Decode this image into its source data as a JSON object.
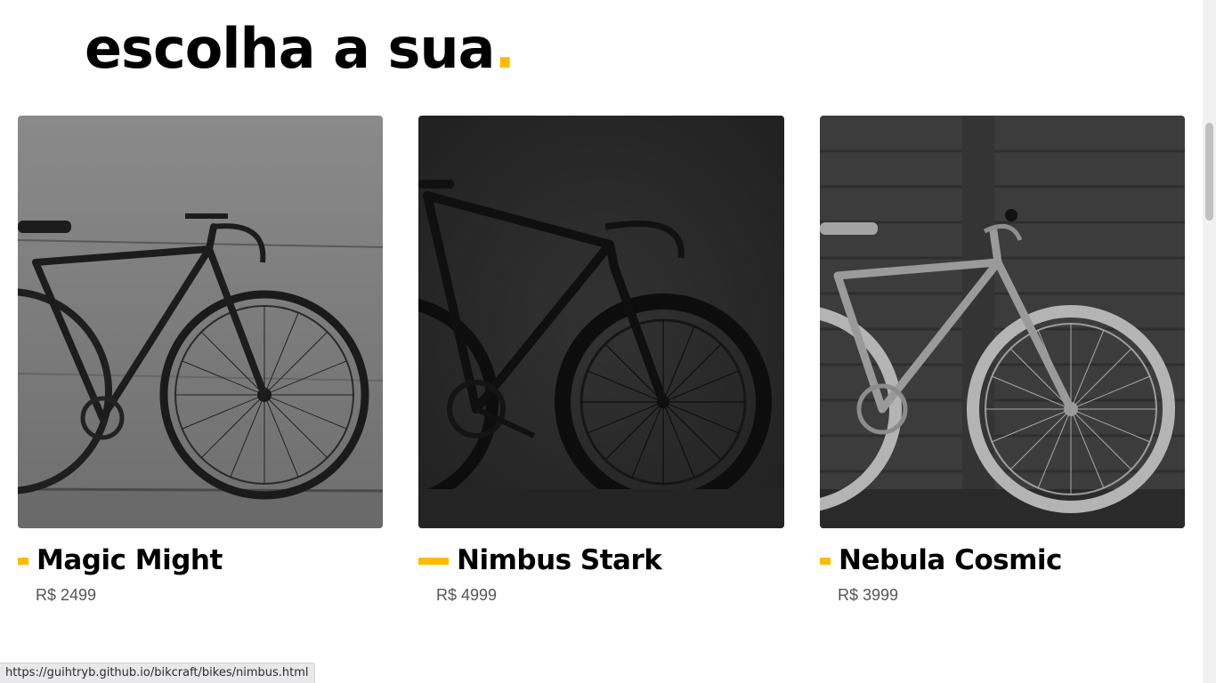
{
  "section": {
    "heading_text": "escolha a sua",
    "heading_dot": "."
  },
  "products": [
    {
      "name": "Magic Might",
      "price": "R$ 2499"
    },
    {
      "name": "Nimbus Stark",
      "price": "R$ 4999"
    },
    {
      "name": "Nebula Cosmic",
      "price": "R$ 3999"
    }
  ],
  "status_bar": {
    "url": "https://guihtryb.github.io/bikcraft/bikes/nimbus.html"
  },
  "colors": {
    "accent": "#FFBB00",
    "text": "#000000",
    "price": "#555555"
  },
  "icons": [
    "bike-photo-magic-might",
    "bike-photo-nimbus-stark",
    "bike-photo-nebula-cosmic"
  ]
}
